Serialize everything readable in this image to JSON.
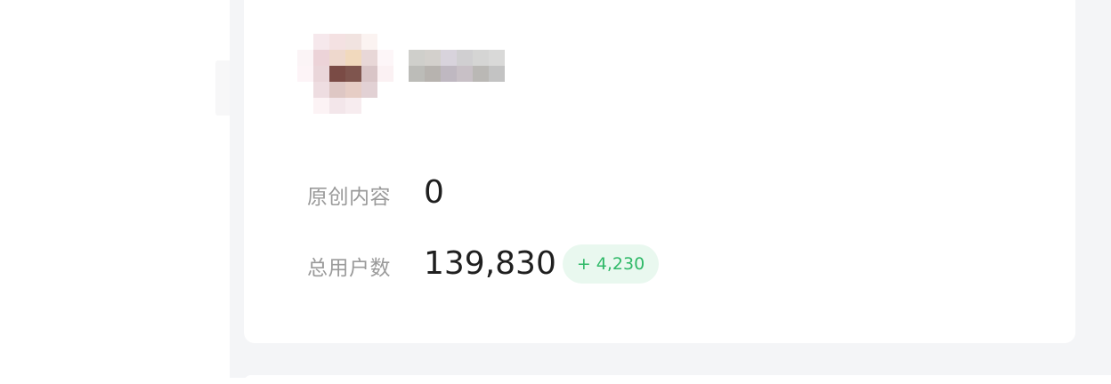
{
  "profile": {
    "avatar_pixels": [
      [
        "#ffffff",
        "#f6e8ec",
        "#f4e1e2",
        "#f1e3e0",
        "#fbf3f1",
        "#ffffff"
      ],
      [
        "#fbf4f6",
        "#ecd3d8",
        "#eed8cd",
        "#f1d9bd",
        "#e8d7d7",
        "#fdf6f8"
      ],
      [
        "#fdf4f7",
        "#ead6da",
        "#7a4b45",
        "#7f554e",
        "#d9c5c7",
        "#fbf1f3"
      ],
      [
        "#ffffff",
        "#eedde1",
        "#dec7c4",
        "#e6cdc5",
        "#e2d1d4",
        "#ffffff"
      ],
      [
        "#ffffff",
        "#fcf3f5",
        "#f3e6ea",
        "#f7ecef",
        "#ffffff",
        "#ffffff"
      ]
    ],
    "username_pixels": [
      [
        "#cfcfcb",
        "#d3d0cc",
        "#d8d3dc",
        "#d0cfd1",
        "#d5d5d4",
        "#d9d9d8"
      ],
      [
        "#bcbcb8",
        "#b7b3af",
        "#bfb8c1",
        "#c8c0c6",
        "#bab8b5",
        "#c3c3c3"
      ]
    ]
  },
  "stats": {
    "original_content": {
      "label": "原创内容",
      "value": "0"
    },
    "total_users": {
      "label": "总用户数",
      "value": "139,830",
      "delta": "+ 4,230"
    }
  },
  "colors": {
    "label_text": "#9a9a9a",
    "value_text": "#1f1f1f",
    "delta_text": "#2fb968",
    "delta_background": "#e9f8ef",
    "page_background": "#f4f5f7",
    "card_background": "#ffffff"
  }
}
